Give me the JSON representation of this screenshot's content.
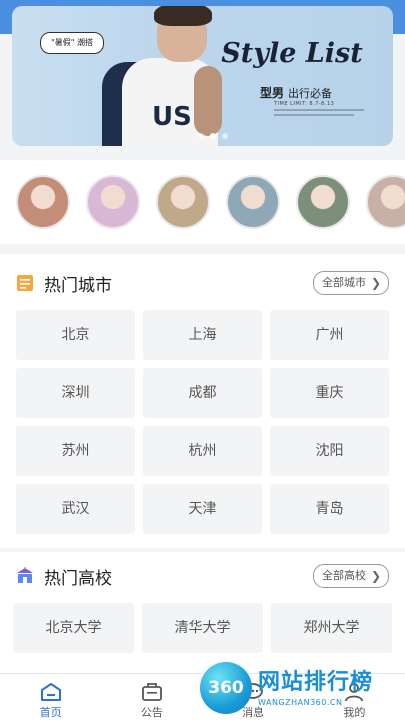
{
  "banner": {
    "tag": "\"暑假\" 潮搭",
    "title": "Style List",
    "sub_bold": "型男",
    "sub_text": "出行必备",
    "time_limit": "TIME LIMIT: 8.7-8.13",
    "model_letters": "US",
    "dots": 3,
    "active_dot": 1
  },
  "avatars": [
    {
      "color": "#c48d78"
    },
    {
      "color": "#d8b8d6"
    },
    {
      "color": "#bfa988"
    },
    {
      "color": "#8fa8b8"
    },
    {
      "color": "#7b8f7a"
    },
    {
      "color": "#c9b0a6"
    }
  ],
  "hot_cities": {
    "title": "热门城市",
    "all_label": "全部城市",
    "items": [
      "北京",
      "上海",
      "广州",
      "深圳",
      "成都",
      "重庆",
      "苏州",
      "杭州",
      "沈阳",
      "武汉",
      "天津",
      "青岛"
    ]
  },
  "hot_schools": {
    "title": "热门高校",
    "all_label": "全部高校",
    "items": [
      "北京大学",
      "清华大学",
      "郑州大学"
    ]
  },
  "tabs": [
    {
      "label": "首页",
      "icon": "home-icon",
      "active": true
    },
    {
      "label": "公告",
      "icon": "notice-icon",
      "active": false
    },
    {
      "label": "消息",
      "icon": "message-icon",
      "active": false
    },
    {
      "label": "我的",
      "icon": "profile-icon",
      "active": false
    }
  ],
  "watermark": {
    "badge": "360",
    "title": "网站排行榜",
    "url": "WANGZHAN360.CN"
  },
  "colors": {
    "accent": "#2f6fd8",
    "top_bar": "#4a8fe0"
  }
}
